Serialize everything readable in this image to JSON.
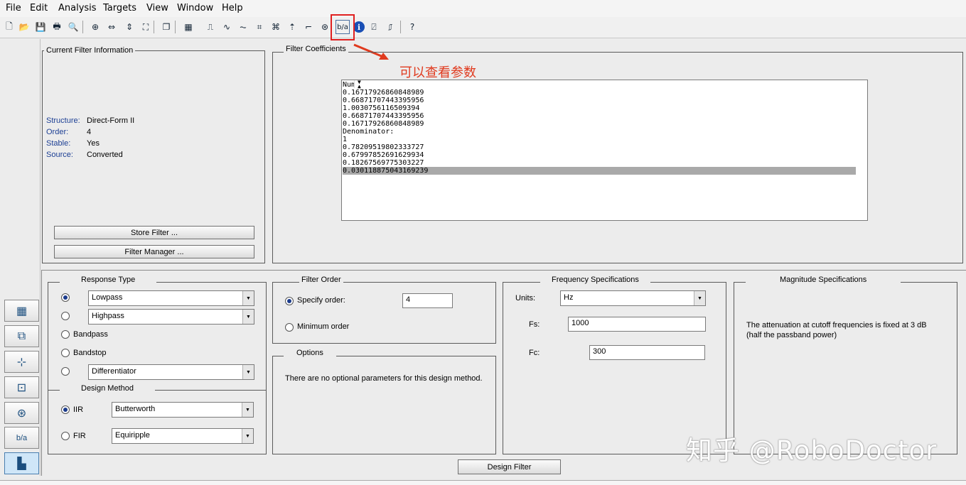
{
  "menu": [
    "File",
    "Edit",
    "Analysis",
    "Targets",
    "View",
    "Window",
    "Help"
  ],
  "toolbar": {
    "icons": [
      "new-icon",
      "open-icon",
      "save-icon",
      "print-icon",
      "print-preview-icon",
      "zoom-in-icon",
      "zoom-x-icon",
      "zoom-y-icon",
      "full-view-icon",
      "new-figure-icon",
      "filter-designer-icon",
      "magnitude-response-icon",
      "phase-response-icon",
      "magnitude-phase-icon",
      "group-delay-icon",
      "phase-delay-icon",
      "impulse-response-icon",
      "step-response-icon",
      "pole-zero-icon",
      "filter-coefficients-icon",
      "filter-info-icon",
      "magnitude-estimate-icon",
      "round-off-noise-icon",
      "whats-this-icon"
    ],
    "glyphs": [
      "🗋",
      "📂",
      "💾",
      "🖶",
      "🔍",
      "⊕",
      "⇔",
      "⇕",
      "⛶",
      "❐",
      "▦",
      "⎍",
      "∿",
      "⏦",
      "⌗",
      "⌘",
      "⇡",
      "⌐",
      "⊛",
      "b/a",
      "ℹ",
      "⍁",
      "⎎",
      "?"
    ]
  },
  "annotation": "可以查看参数",
  "current_info": {
    "title": "Current Filter Information",
    "rows": [
      {
        "label": "Structure:",
        "value": "Direct-Form II"
      },
      {
        "label": "Order:",
        "value": "4"
      },
      {
        "label": "Stable:",
        "value": "Yes"
      },
      {
        "label": "Source:",
        "value": "Converted"
      }
    ],
    "store_btn": "Store Filter ...",
    "manager_btn": "Filter Manager ..."
  },
  "coefficients": {
    "title": "Filter Coefficients",
    "lines": [
      "Numerator:",
      "0.16717926860848989",
      "0.66871707443395956",
      "1.0030756116509394",
      "0.66871707443395956",
      "0.16717926860848989",
      "Denominator:",
      "1",
      "0.78209519802333727",
      "0.67997852691629934",
      "0.18267569775303227",
      "0.030118875043169239"
    ],
    "selected_index": 11
  },
  "response_type": {
    "title": "Response Type",
    "lowpass": "Lowpass",
    "highpass": "Highpass",
    "bandpass": "Bandpass",
    "bandstop": "Bandstop",
    "differentiator": "Differentiator"
  },
  "design_method": {
    "title": "Design Method",
    "iir_label": "IIR",
    "iir_value": "Butterworth",
    "fir_label": "FIR",
    "fir_value": "Equiripple"
  },
  "filter_order": {
    "title": "Filter Order",
    "specify_label": "Specify order:",
    "specify_value": "4",
    "minimum_label": "Minimum order"
  },
  "options": {
    "title": "Options",
    "text": "There are no optional parameters for this design method."
  },
  "frequency": {
    "title": "Frequency Specifications",
    "units_label": "Units:",
    "units_value": "Hz",
    "fs_label": "Fs:",
    "fs_value": "1000",
    "fc_label": "Fc:",
    "fc_value": "300"
  },
  "magnitude": {
    "title": "Magnitude Specifications",
    "text1": "The attenuation at cutoff frequencies is fixed at 3 dB",
    "text2": "(half the passband power)"
  },
  "design_btn": "Design Filter",
  "sidebar": [
    "▦",
    "⧉",
    "⊹",
    "⊡",
    "⊛",
    "b/a",
    "▙"
  ],
  "watermark": "知乎 @RoboDoctor",
  "colors": {
    "annotation": "#e03a1e",
    "highlight": "#e02020",
    "label_blue": "#1c3f94"
  }
}
